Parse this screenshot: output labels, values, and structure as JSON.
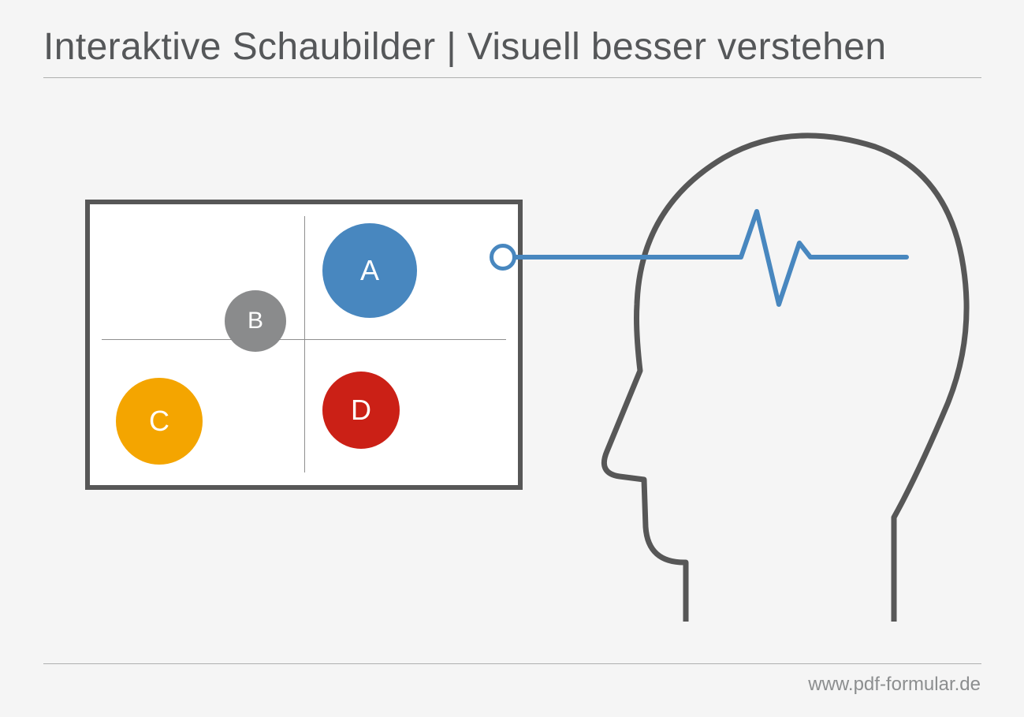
{
  "title": "Interaktive Schaubilder | Visuell besser verstehen",
  "footer_url": "www.pdf-formular.de",
  "colors": {
    "frame": "#575757",
    "axis": "#8f8f8f",
    "blue": "#4887bf",
    "grey": "#8a8b8c",
    "orange": "#f4a500",
    "red": "#cb2016",
    "text": "#555759"
  },
  "nodes": {
    "a": {
      "label": "A",
      "color": "#4887bf"
    },
    "b": {
      "label": "B",
      "color": "#8a8b8c"
    },
    "c": {
      "label": "C",
      "color": "#f4a500"
    },
    "d": {
      "label": "D",
      "color": "#cb2016"
    }
  }
}
